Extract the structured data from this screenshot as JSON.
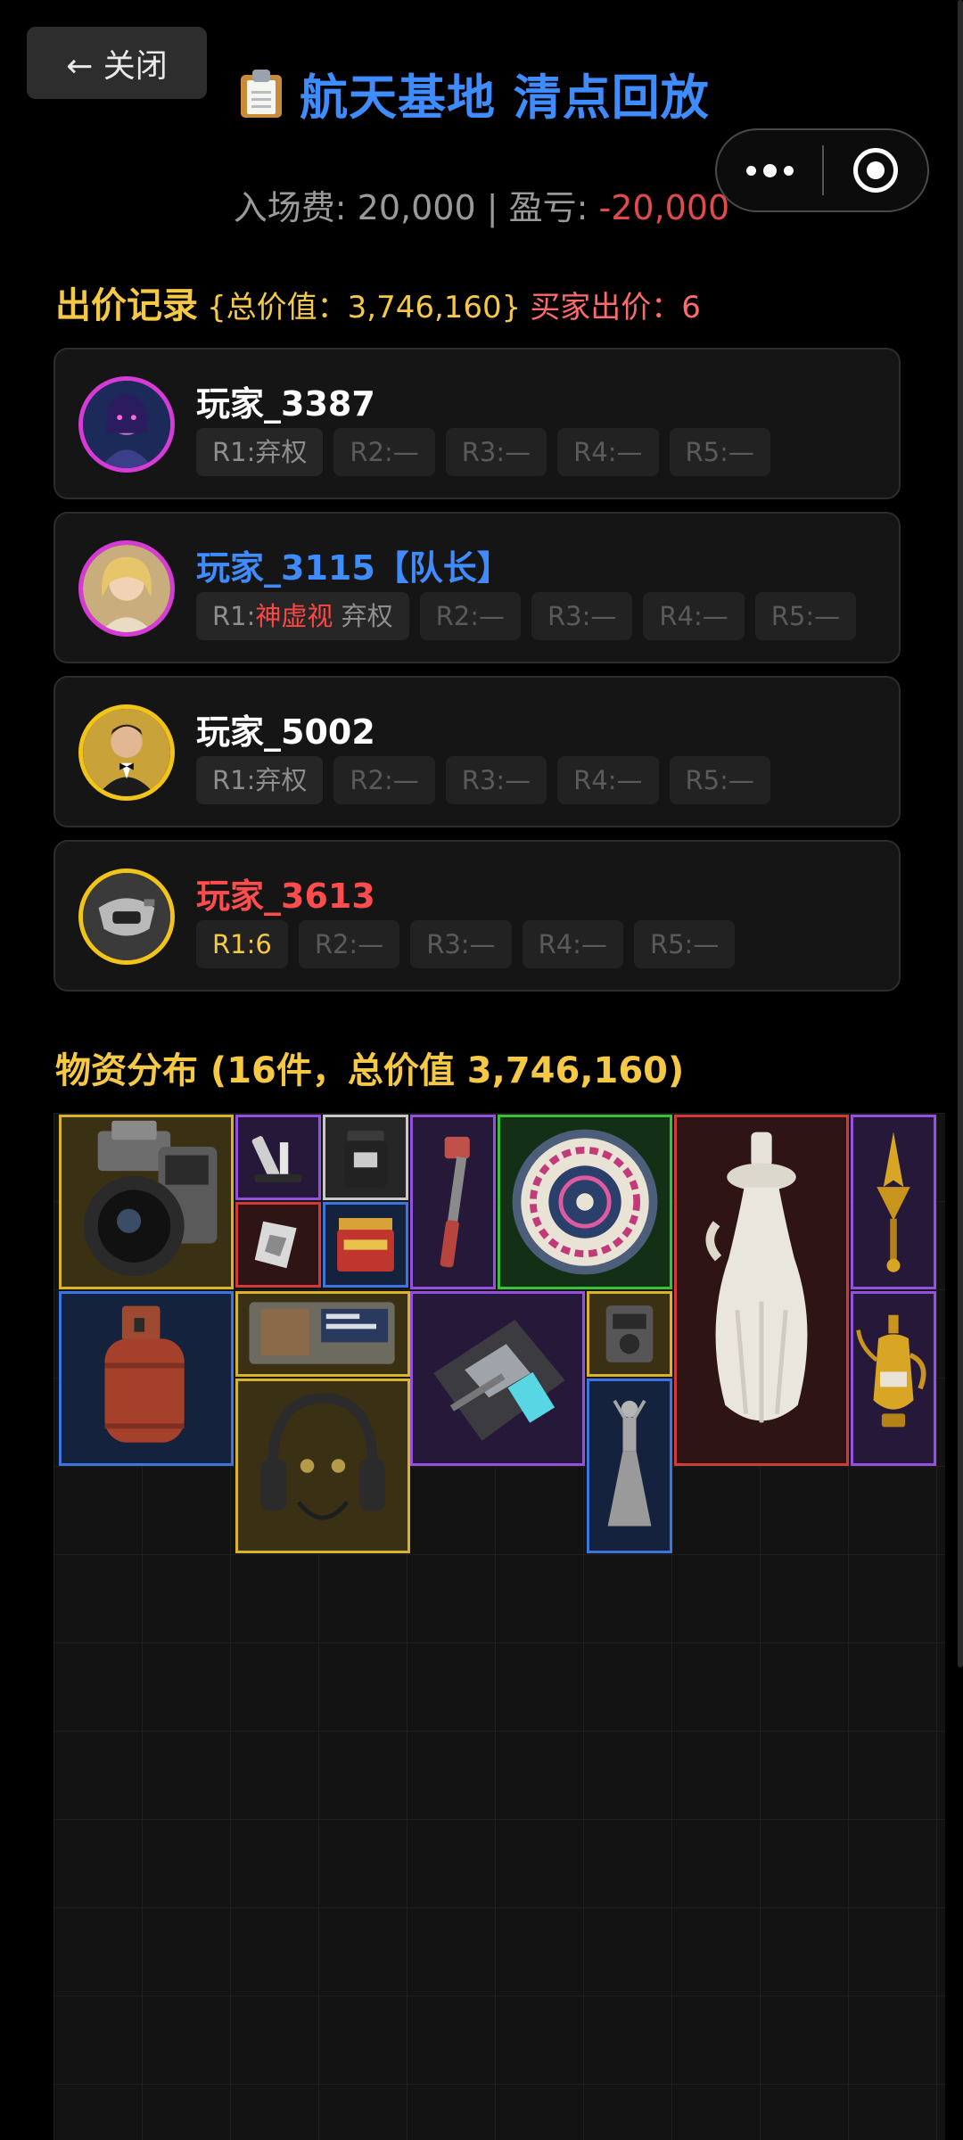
{
  "header": {
    "close_label": "← 关闭",
    "title": "航天基地 清点回放",
    "title_icon": "clipboard-icon",
    "capsule": {
      "more_icon": "more-dots-icon",
      "close_icon": "target-icon"
    }
  },
  "fee": {
    "label": "入场费: 20,000 | 盈亏: ",
    "profit": "-20,000"
  },
  "bids": {
    "title": "出价记录",
    "total": "{总价值：3,746,160}",
    "buyer": "买家出价：6"
  },
  "players": [
    {
      "name": "玩家_3387",
      "name_color": "#ffffff",
      "ring_color": "#d63bd6",
      "avatar": "avatar-neon-girl",
      "rounds": [
        {
          "label": "R1:弃权",
          "state": "active"
        },
        {
          "label": "R2:—",
          "state": "empty"
        },
        {
          "label": "R3:—",
          "state": "empty"
        },
        {
          "label": "R4:—",
          "state": "empty"
        },
        {
          "label": "R5:—",
          "state": "empty"
        }
      ]
    },
    {
      "name": "玩家_3115【队长】",
      "name_color": "#3f8cff",
      "ring_color": "#d63bd6",
      "avatar": "avatar-blonde",
      "rounds": [
        {
          "prefix": "R1:",
          "highlight": "神虚视",
          "suffix": " 弃权",
          "state": "active"
        },
        {
          "label": "R2:—",
          "state": "empty"
        },
        {
          "label": "R3:—",
          "state": "empty"
        },
        {
          "label": "R4:—",
          "state": "empty"
        },
        {
          "label": "R5:—",
          "state": "empty"
        }
      ]
    },
    {
      "name": "玩家_5002",
      "name_color": "#ffffff",
      "ring_color": "#f2c418",
      "avatar": "avatar-tuxedo-man",
      "rounds": [
        {
          "label": "R1:弃权",
          "state": "active"
        },
        {
          "label": "R2:—",
          "state": "empty"
        },
        {
          "label": "R3:—",
          "state": "empty"
        },
        {
          "label": "R4:—",
          "state": "empty"
        },
        {
          "label": "R5:—",
          "state": "empty"
        }
      ]
    },
    {
      "name": "玩家_3613",
      "name_color": "#ff4d4d",
      "ring_color": "#f2c418",
      "avatar": "avatar-helmet",
      "rounds": [
        {
          "label": "R1:6",
          "state": "gold"
        },
        {
          "label": "R2:—",
          "state": "empty"
        },
        {
          "label": "R3:—",
          "state": "empty"
        },
        {
          "label": "R4:—",
          "state": "empty"
        },
        {
          "label": "R5:—",
          "state": "empty"
        }
      ]
    }
  ],
  "items_section": {
    "title": "物资分布 (16件，总价值 3,746,160)"
  },
  "items": [
    {
      "name": "camera",
      "quality": "gold"
    },
    {
      "name": "gun-scope",
      "quality": "purple"
    },
    {
      "name": "supplement-jar",
      "quality": "white"
    },
    {
      "name": "pipe-wrench",
      "quality": "purple"
    },
    {
      "name": "ornate-plate",
      "quality": "green"
    },
    {
      "name": "porcelain-vase",
      "quality": "red"
    },
    {
      "name": "golden-ornament",
      "quality": "purple"
    },
    {
      "name": "usb-drive",
      "quality": "red"
    },
    {
      "name": "tea-tin",
      "quality": "blue"
    },
    {
      "name": "gas-tank",
      "quality": "blue"
    },
    {
      "name": "electronic-device",
      "quality": "gold"
    },
    {
      "name": "motherboard",
      "quality": "purple"
    },
    {
      "name": "radio-device",
      "quality": "gold"
    },
    {
      "name": "golden-teapot",
      "quality": "purple"
    },
    {
      "name": "headset",
      "quality": "gold"
    },
    {
      "name": "dancer-statue",
      "quality": "blue"
    }
  ]
}
